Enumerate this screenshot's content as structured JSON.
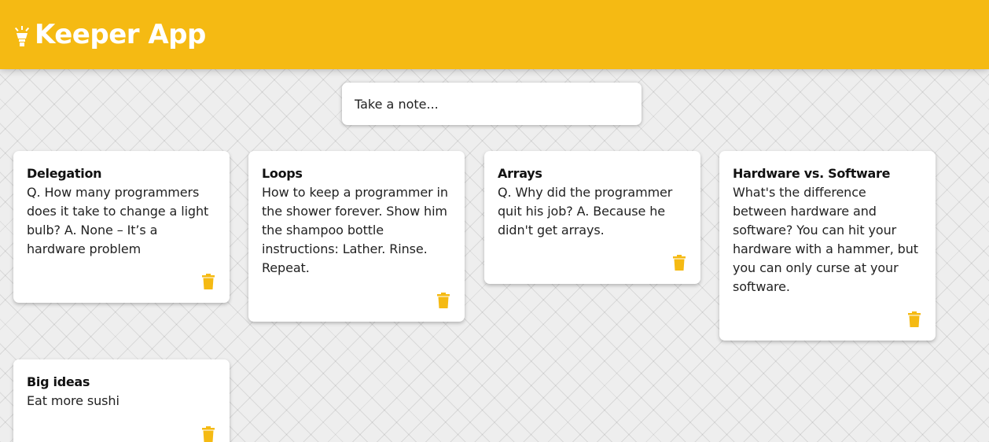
{
  "header": {
    "title": "Keeper App",
    "icon": "lightbulb-icon",
    "color": "#f5ba13"
  },
  "create_note": {
    "placeholder": "Take a note..."
  },
  "notes": [
    {
      "title": "Delegation",
      "content": "Q. How many programmers does it take to change a light bulb? A. None – It’s a hardware problem"
    },
    {
      "title": "Loops",
      "content": "How to keep a programmer in the shower forever. Show him the shampoo bottle instructions: Lather. Rinse. Repeat."
    },
    {
      "title": "Arrays",
      "content": "Q. Why did the programmer quit his job? A. Because he didn't get arrays."
    },
    {
      "title": "Hardware vs. Software",
      "content": "What's the difference between hardware and software? You can hit your hardware with a hammer, but you can only curse at your software."
    },
    {
      "title": "Big ideas",
      "content": "Eat more sushi"
    }
  ],
  "note_delete_icon": "trash-icon",
  "accent_color": "#f5ba13"
}
